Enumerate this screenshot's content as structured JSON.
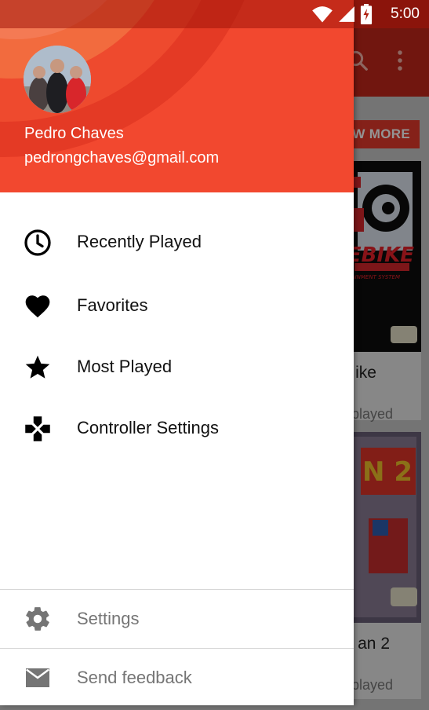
{
  "status_bar": {
    "time": "5:00"
  },
  "background": {
    "view_more_label": "W MORE",
    "cards": [
      {
        "title_fragment": "ike",
        "subtitle_fragment": "played",
        "cover_text": "EBIKE",
        "cover_sub": "ENTERTAINMENT SYSTEM"
      },
      {
        "title_fragment": "an 2",
        "subtitle_fragment": "played",
        "cover_text": "N 2",
        "cover_sub": ""
      }
    ]
  },
  "drawer": {
    "user": {
      "name": "Pedro Chaves",
      "email": "pedrongchaves@gmail.com"
    },
    "menu": [
      {
        "label": "Recently Played",
        "icon": "clock-icon"
      },
      {
        "label": "Favorites",
        "icon": "heart-icon"
      },
      {
        "label": "Most Played",
        "icon": "star-icon"
      },
      {
        "label": "Controller Settings",
        "icon": "gamepad-icon"
      }
    ],
    "footer": [
      {
        "label": "Settings",
        "icon": "gear-icon"
      },
      {
        "label": "Send feedback",
        "icon": "mail-icon"
      }
    ]
  },
  "colors": {
    "header_red": "#f2482f",
    "toolbar_red": "#c3271a",
    "menu_text": "#111111",
    "footer_text": "#757575"
  }
}
